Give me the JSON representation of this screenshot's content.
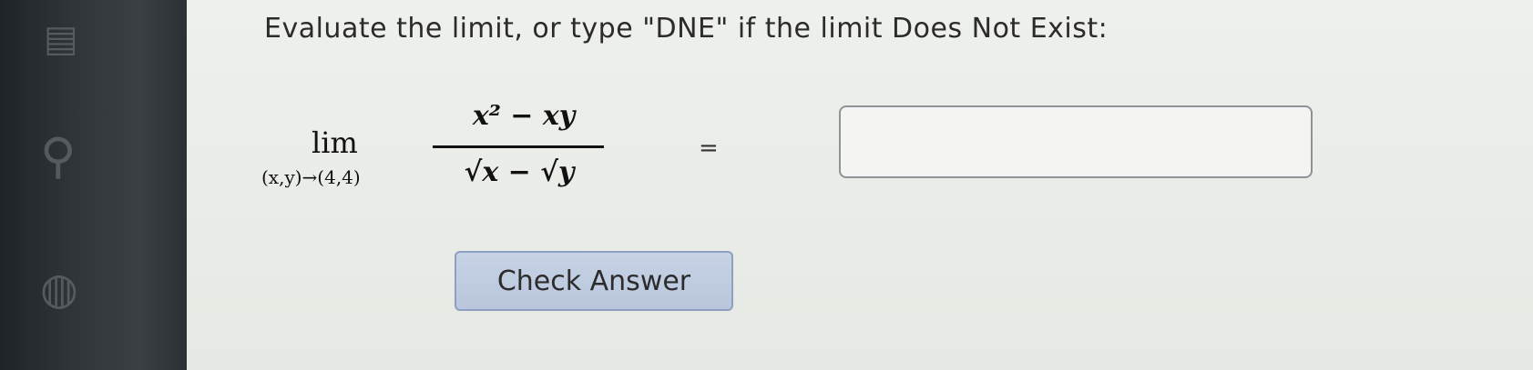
{
  "question": {
    "prompt": "Evaluate the limit, or type \"DNE\" if the limit Does Not Exist:"
  },
  "expression": {
    "lim_word": "lim",
    "lim_subscript": "(x,y)→(4,4)",
    "numerator": "x² − xy",
    "denominator": "√x − √y",
    "equals": "="
  },
  "answer": {
    "value": "",
    "placeholder": ""
  },
  "actions": {
    "check_label": "Check Answer"
  },
  "sidebar": {
    "icons": [
      "app-icon",
      "search-icon",
      "globe-icon"
    ]
  }
}
